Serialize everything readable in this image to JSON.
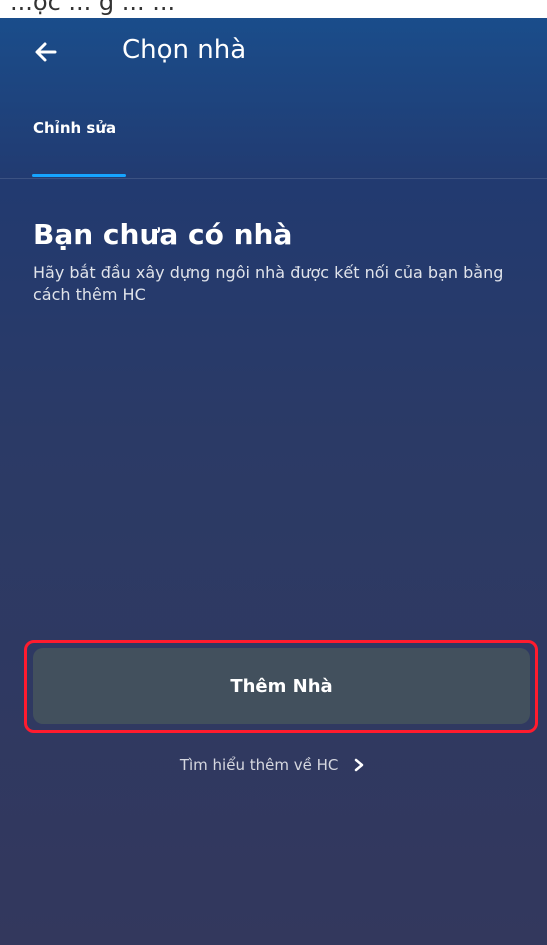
{
  "app": {
    "title": "Chọn nhà"
  },
  "tabs": [
    {
      "label": "Chỉnh sửa"
    }
  ],
  "empty_state": {
    "title": "Bạn chưa có nhà",
    "description": "Hãy bắt đầu xây dựng ngôi nhà được kết nối của bạn bằng cách thêm HC"
  },
  "actions": {
    "add_home_label": "Thêm Nhà",
    "learn_more_label": "Tìm hiểu thêm về HC"
  },
  "top_clip": {
    "text": "...ợc ... g ... ..."
  },
  "icons": {
    "back": "arrow-left-icon",
    "learn_more": "chevron-right-icon"
  },
  "colors": {
    "tab_indicator": "#16a4ff",
    "button_background": "#42505d",
    "highlight": "#ff1b2e"
  }
}
